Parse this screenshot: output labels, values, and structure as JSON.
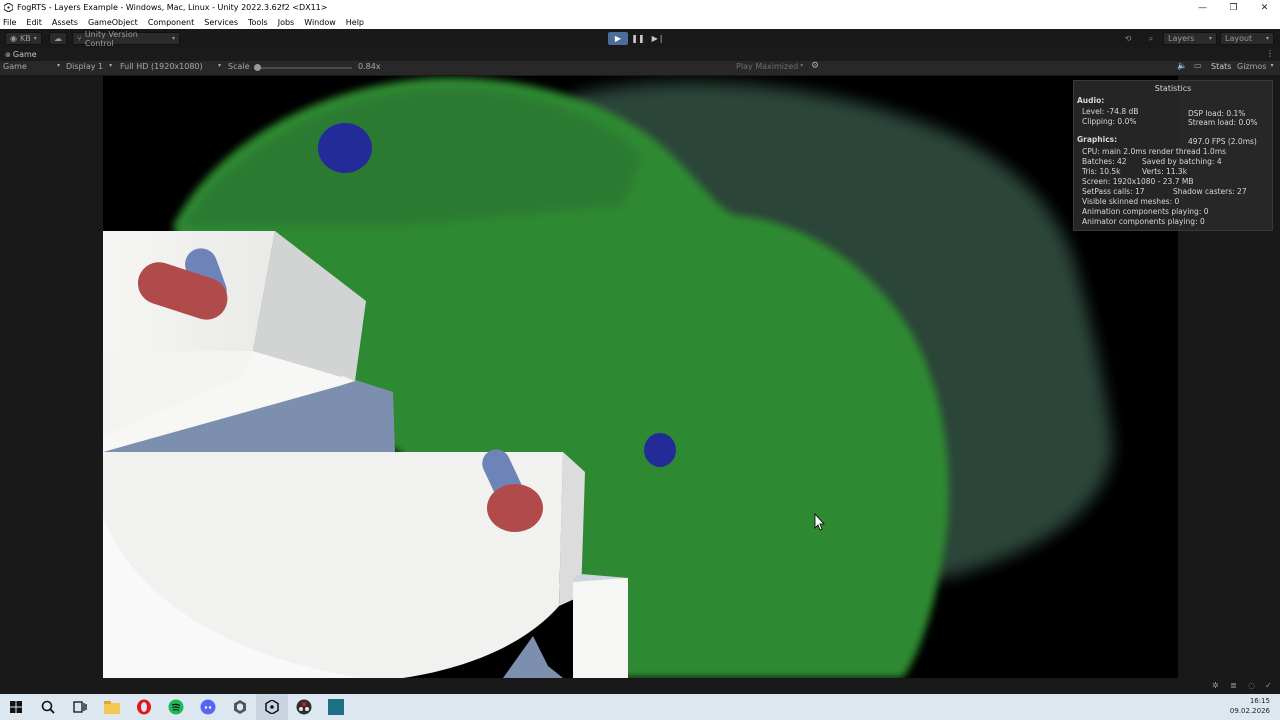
{
  "window": {
    "title": "FogRTS - Layers Example - Windows, Mac, Linux - Unity 2022.3.62f2 <DX11>",
    "minimize": "—",
    "restore": "❐",
    "close": "✕"
  },
  "menu": [
    "File",
    "Edit",
    "Assets",
    "GameObject",
    "Component",
    "Services",
    "Tools",
    "Jobs",
    "Window",
    "Help"
  ],
  "toolbar": {
    "account": "KB",
    "version_control": "Unity Version Control",
    "layers": "Layers",
    "layout": "Layout"
  },
  "tab": {
    "label": "Game"
  },
  "gamebar": {
    "mode": "Game",
    "display": "Display 1",
    "resolution": "Full HD (1920x1080)",
    "scale_label": "Scale",
    "scale_value": "0.84x",
    "play_maximized": "Play Maximized",
    "stats": "Stats",
    "gizmos": "Gizmos"
  },
  "stats": {
    "title": "Statistics",
    "audio_header": "Audio:",
    "level": "Level: -74.8 dB",
    "clipping": "Clipping: 0.0%",
    "dsp_load": "DSP load: 0.1%",
    "stream_load": "Stream load: 0.0%",
    "graphics_header": "Graphics:",
    "fps": "497.0 FPS (2.0ms)",
    "cpu": "CPU: main 2.0ms  render thread 1.0ms",
    "batches": "Batches: 42",
    "saved_batching": "Saved by batching: 4",
    "tris": "Tris: 10.5k",
    "verts": "Verts: 11.3k",
    "screen": "Screen: 1920x1080 - 23.7 MB",
    "setpass": "SetPass calls: 17",
    "shadow_casters": "Shadow casters: 27",
    "skinned": "Visible skinned meshes: 0",
    "animation": "Animation components playing: 0",
    "animator": "Animator components playing: 0"
  },
  "clock": {
    "time": "16:15",
    "date": "09.02.2026"
  },
  "colors": {
    "fog_green": "#2e8a2e",
    "fog_dark": "#2d4a3c",
    "unit_blue": "#232b99",
    "unit_red": "#b14a4a",
    "block_white": "#f2f2f0",
    "block_slate": "#7d8fae"
  },
  "taskbar_icons": [
    "windows-start-icon",
    "search-icon",
    "task-view-icon",
    "file-explorer-icon",
    "opera-icon",
    "spotify-icon",
    "discord-icon",
    "unity-hub-icon",
    "unity-icon",
    "obs-icon",
    "app-icon"
  ]
}
